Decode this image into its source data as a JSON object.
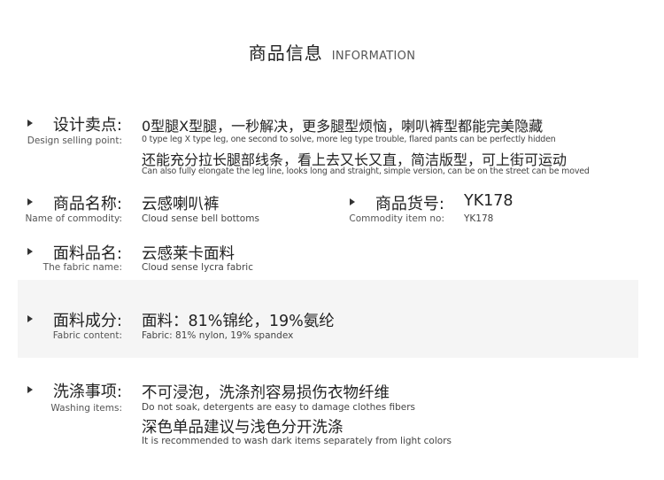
{
  "header": {
    "title_cn": "商品信息",
    "title_en": "INFORMATION"
  },
  "selling_point": {
    "label_cn": "设计卖点:",
    "label_en": "Design selling point:",
    "line1_cn": "0型腿X型腿，一秒解决，更多腿型烦恼，喇叭裤型都能完美隐藏",
    "line1_en": "0 type leg X type leg, one second to solve, more leg type trouble, flared pants can be perfectly hidden",
    "line2_cn": "还能充分拉长腿部线条，看上去又长又直，简洁版型，可上街可运动",
    "line2_en": "Can also fully elongate the leg line, looks long and straight, simple version, can be on the street can be moved"
  },
  "commodity_name": {
    "label_cn": "商品名称:",
    "label_en": "Name of commodity:",
    "value_cn": "云感喇叭裤",
    "value_en": "Cloud sense bell bottoms"
  },
  "item_no": {
    "label_cn": "商品货号:",
    "label_en": "Commodity item no:",
    "value_cn": "YK178",
    "value_en": "YK178"
  },
  "fabric_name": {
    "label_cn": "面料品名:",
    "label_en": "The fabric name:",
    "value_cn": "云感莱卡面料",
    "value_en": "Cloud sense lycra fabric"
  },
  "fabric_content": {
    "label_cn": "面料成分:",
    "label_en": "Fabric content:",
    "value_cn": "面料：81%锦纶，19%氨纶",
    "value_en": "Fabric: 81% nylon, 19% spandex"
  },
  "washing": {
    "label_cn": "洗涤事项:",
    "label_en": "Washing items:",
    "line1_cn": "不可浸泡，洗涤剂容易损伤衣物纤维",
    "line1_en": "Do not soak, detergents are easy to damage clothes fibers",
    "line2_cn": "深色单品建议与浅色分开洗涤",
    "line2_en": "It is recommended to wash dark items separately from light colors"
  }
}
